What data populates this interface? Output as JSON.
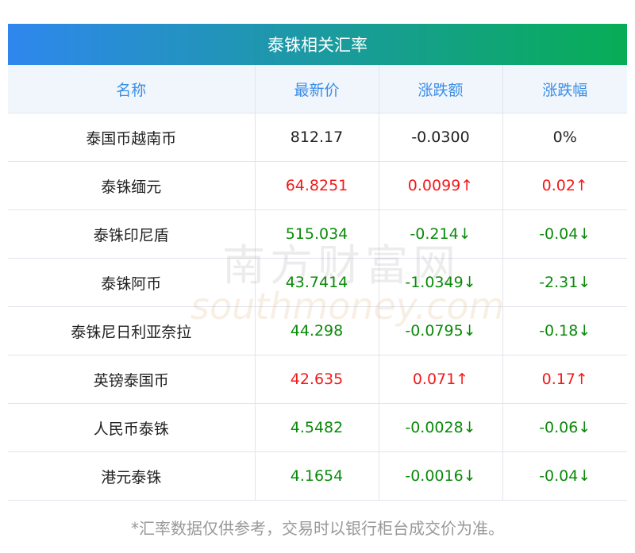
{
  "title": "泰铢相关汇率",
  "headers": [
    "名称",
    "最新价",
    "涨跌额",
    "涨跌幅"
  ],
  "rows": [
    {
      "name": "泰国币越南币",
      "price": "812.17",
      "change": "-0.0300",
      "pct": "0%",
      "dir": "flat"
    },
    {
      "name": "泰铢缅元",
      "price": "64.8251",
      "change": "0.0099↑",
      "pct": "0.02↑",
      "dir": "up"
    },
    {
      "name": "泰铢印尼盾",
      "price": "515.034",
      "change": "-0.214↓",
      "pct": "-0.04↓",
      "dir": "down"
    },
    {
      "name": "泰铢阿币",
      "price": "43.7414",
      "change": "-1.0349↓",
      "pct": "-2.31↓",
      "dir": "down"
    },
    {
      "name": "泰铢尼日利亚奈拉",
      "price": "44.298",
      "change": "-0.0795↓",
      "pct": "-0.18↓",
      "dir": "down"
    },
    {
      "name": "英镑泰国币",
      "price": "42.635",
      "change": "0.071↑",
      "pct": "0.17↑",
      "dir": "up"
    },
    {
      "name": "人民币泰铢",
      "price": "4.5482",
      "change": "-0.0028↓",
      "pct": "-0.06↓",
      "dir": "down"
    },
    {
      "name": "港元泰铢",
      "price": "4.1654",
      "change": "-0.0016↓",
      "pct": "-0.04↓",
      "dir": "down"
    }
  ],
  "note": "*汇率数据仅供参考，交易时以银行柜台成交价为准。",
  "watermark": {
    "cn": "南方财富网",
    "en": "southmoney.com"
  },
  "colors": {
    "up": "#f21a1a",
    "down": "#0a8a0a",
    "header": "#3a8ee6"
  }
}
